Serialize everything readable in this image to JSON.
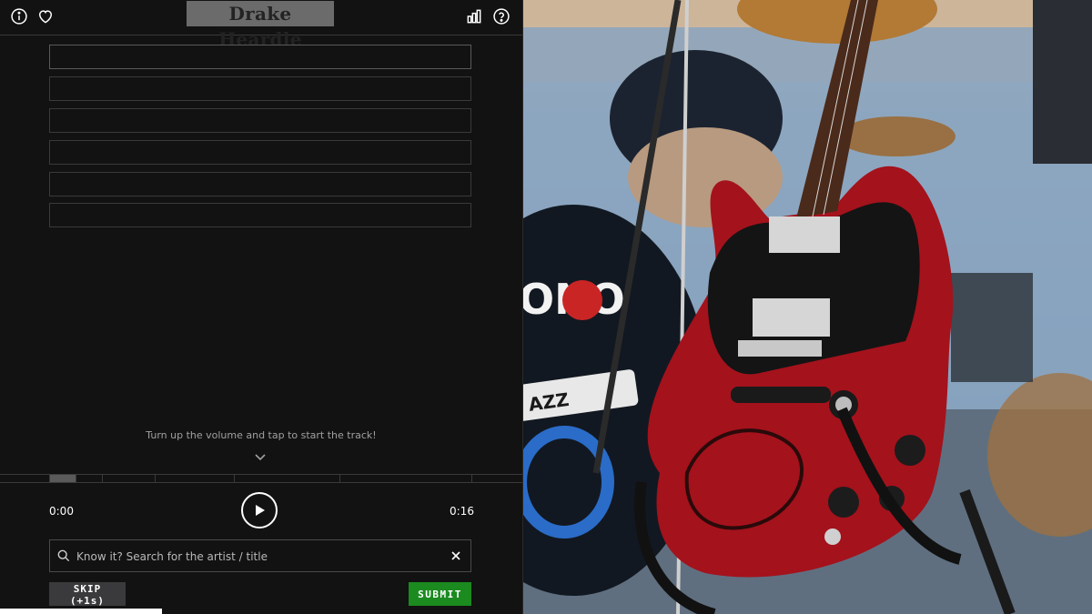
{
  "header": {
    "title": "Drake Heardle",
    "left_icons": [
      "info-icon",
      "heart-icon"
    ],
    "right_icons": [
      "stats-icon",
      "help-icon"
    ]
  },
  "guesses": {
    "rows": 6,
    "filled": 0
  },
  "hint": {
    "text": "Turn up the volume and tap to start the track!"
  },
  "player": {
    "time_start": "0:00",
    "time_end": "0:16",
    "progress_fraction": 0
  },
  "search": {
    "value": "",
    "placeholder": "Know it? Search for the artist / title"
  },
  "actions": {
    "skip_label": "SKIP (+1s)",
    "submit_label": "SUBMIT"
  },
  "colors": {
    "background": "#121212",
    "border": "#3a3a3c",
    "submit": "#1b8a1f",
    "title_bg": "#6b6b6b",
    "guitar_red": "#b0141e"
  },
  "photo": {
    "subject": "red electric guitar in front of drum kit",
    "drum_lettering": "ONO",
    "sticker_lettering": "AZZ"
  }
}
